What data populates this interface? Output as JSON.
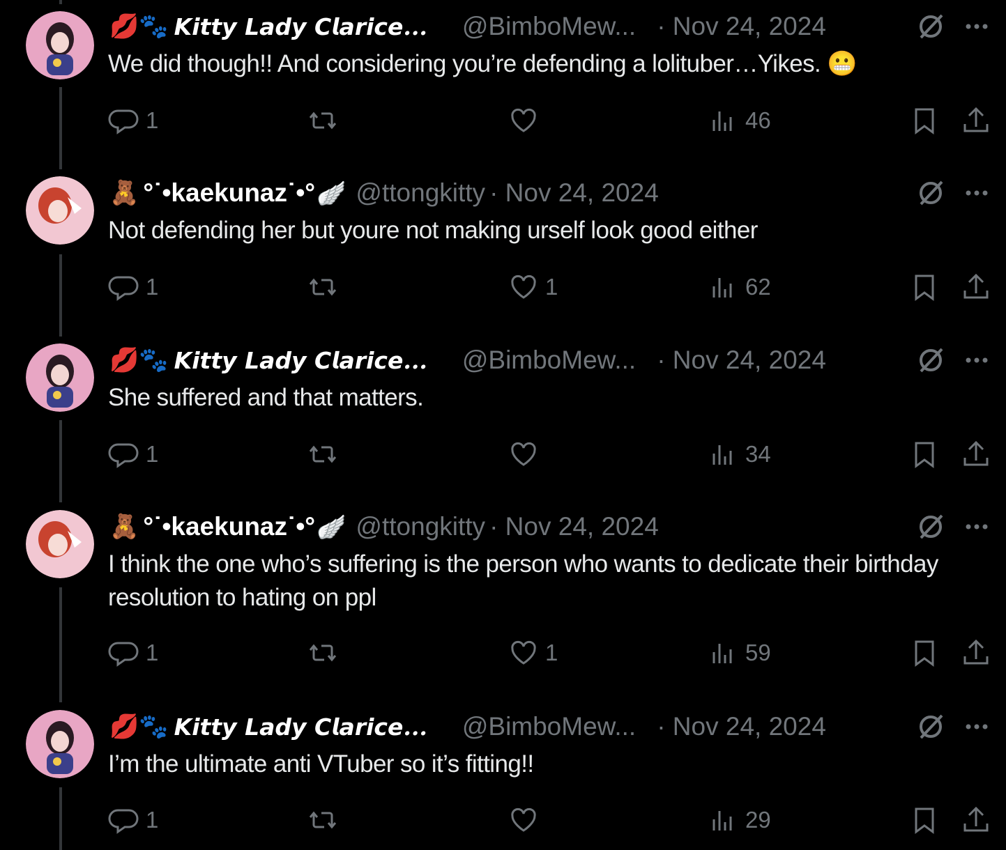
{
  "colors": {
    "background": "#000000",
    "text": "#e7e9ea",
    "muted": "#71767b",
    "thread_line": "#333639"
  },
  "tweets": [
    {
      "author_emoji": "💋🐾",
      "author_name": "𝙆𝙞𝙩𝙩𝙮 𝙇𝙖𝙙𝙮 𝘾𝙡𝙖𝙧𝙞𝙘𝙚...",
      "handle": "@BimboMew...",
      "date": "· Nov 24, 2024",
      "text": "We did though!!  And considering you’re defending a lolituber…Yikes. 😬",
      "replies": "1",
      "retweets": "",
      "likes": "",
      "views": "46"
    },
    {
      "author_emoji": "🧸",
      "author_name": "°˙•kaekunaz˙•°",
      "author_suffix": "🪽",
      "handle": "@ttongkitty",
      "date": "· Nov 24, 2024",
      "text": "Not defending her but youre not making urself look good either",
      "replies": "1",
      "retweets": "",
      "likes": "1",
      "views": "62"
    },
    {
      "author_emoji": "💋🐾",
      "author_name": "𝙆𝙞𝙩𝙩𝙮 𝙇𝙖𝙙𝙮 𝘾𝙡𝙖𝙧𝙞𝙘𝙚...",
      "handle": "@BimboMew...",
      "date": "· Nov 24, 2024",
      "text": "She suffered and that matters.",
      "replies": "1",
      "retweets": "",
      "likes": "",
      "views": "34"
    },
    {
      "author_emoji": "🧸",
      "author_name": "°˙•kaekunaz˙•°",
      "author_suffix": "🪽",
      "handle": "@ttongkitty",
      "date": "· Nov 24, 2024",
      "text": "I think the one who’s suffering is the person who wants to dedicate their birthday resolution to hating on ppl",
      "replies": "1",
      "retweets": "",
      "likes": "1",
      "views": "59"
    },
    {
      "author_emoji": "💋🐾",
      "author_name": "𝙆𝙞𝙩𝙩𝙮 𝙇𝙖𝙙𝙮 𝘾𝙡𝙖𝙧𝙞𝙘𝙚...",
      "handle": "@BimboMew...",
      "date": "· Nov 24, 2024",
      "text": "I’m the ultimate anti VTuber so it’s fitting!!",
      "replies": "1",
      "retweets": "",
      "likes": "",
      "views": "29"
    }
  ],
  "icons": {
    "reply": "reply-icon",
    "retweet": "retweet-icon",
    "like": "heart-icon",
    "views": "views-icon",
    "bookmark": "bookmark-icon",
    "share": "share-icon",
    "grok": "grok-icon",
    "more": "more-icon"
  }
}
